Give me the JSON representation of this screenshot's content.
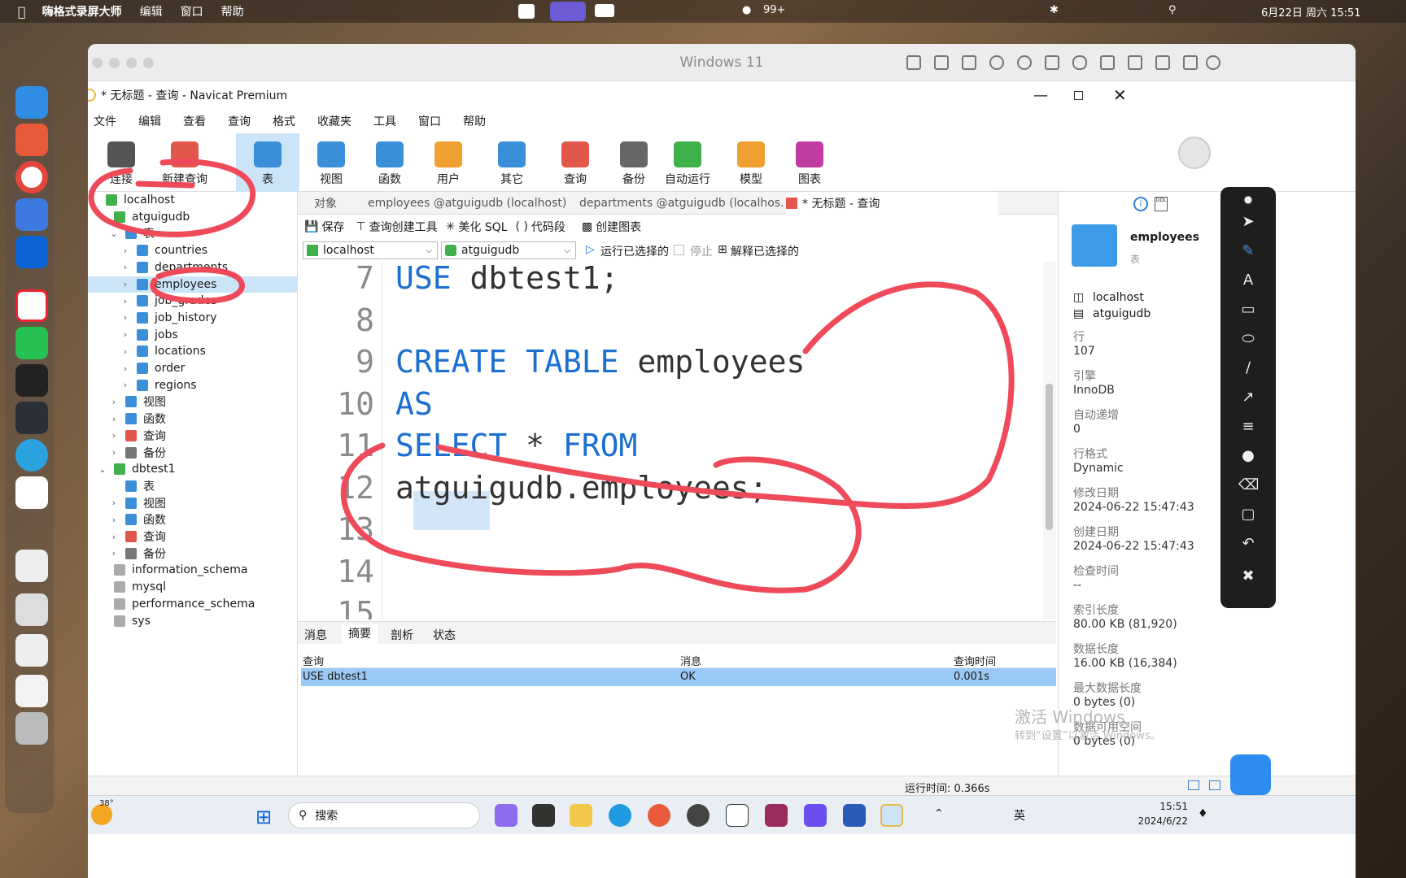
{
  "menubar": {
    "app": "嗨格式录屏大师",
    "items": [
      "编辑",
      "窗口",
      "帮助"
    ],
    "badge": "99+",
    "datetime": "6月22日 周六 15:51"
  },
  "vm": {
    "title": "Windows 11"
  },
  "navicat": {
    "window_title": "* 无标题 - 查询 - Navicat Premium",
    "menu": [
      "文件",
      "编辑",
      "查看",
      "查询",
      "格式",
      "收藏夹",
      "工具",
      "窗口",
      "帮助"
    ],
    "toolbar": [
      {
        "label": "连接",
        "icon": "plug-icon"
      },
      {
        "label": "新建查询",
        "icon": "new-query-icon"
      },
      {
        "label": "表",
        "icon": "table-icon"
      },
      {
        "label": "视图",
        "icon": "view-icon"
      },
      {
        "label": "函数",
        "icon": "function-icon"
      },
      {
        "label": "用户",
        "icon": "user-icon"
      },
      {
        "label": "其它",
        "icon": "tools-icon"
      },
      {
        "label": "查询",
        "icon": "query-icon"
      },
      {
        "label": "备份",
        "icon": "backup-icon"
      },
      {
        "label": "自动运行",
        "icon": "robot-icon"
      },
      {
        "label": "模型",
        "icon": "model-icon"
      },
      {
        "label": "图表",
        "icon": "chart-icon"
      }
    ],
    "tree": {
      "connection": "localhost",
      "db1": "atguigudb",
      "tables_label": "表",
      "tables": [
        "countries",
        "departments",
        "employees",
        "job_grades",
        "job_history",
        "jobs",
        "locations",
        "order",
        "regions"
      ],
      "db1_children": [
        "视图",
        "函数",
        "查询",
        "备份"
      ],
      "db2": "dbtest1",
      "db2_children": [
        "表",
        "视图",
        "函数",
        "查询",
        "备份"
      ],
      "others": [
        "information_schema",
        "mysql",
        "performance_schema",
        "sys"
      ]
    },
    "tabs": [
      "对象",
      "employees @atguigudb (localhost) ...",
      "departments @atguigudb (localhos...",
      "* 无标题 - 查询"
    ],
    "query_toolbar": [
      "保存",
      "查询创建工具",
      "美化 SQL",
      "代码段",
      "创建图表"
    ],
    "conn_select": "localhost",
    "db_select": "atguigudb",
    "run_actions": [
      "运行已选择的",
      "停止",
      "解释已选择的"
    ],
    "editor": {
      "lines": [
        {
          "n": "7",
          "code": [
            {
              "t": "USE ",
              "k": 1
            },
            {
              "t": "dbtest1;",
              "k": 0
            }
          ]
        },
        {
          "n": "8",
          "code": []
        },
        {
          "n": "9",
          "code": [
            {
              "t": "CREATE TABLE ",
              "k": 1
            },
            {
              "t": "employees",
              "k": 0
            }
          ]
        },
        {
          "n": "10",
          "code": [
            {
              "t": "AS",
              "k": 1
            }
          ]
        },
        {
          "n": "11",
          "code": [
            {
              "t": "SELECT",
              "k": 1
            },
            {
              "t": " * ",
              "k": 0
            },
            {
              "t": "FROM",
              "k": 1
            }
          ]
        },
        {
          "n": "12",
          "code": [
            {
              "t": "atguigudb.employees;",
              "k": 0
            }
          ]
        },
        {
          "n": "13",
          "code": []
        },
        {
          "n": "14",
          "code": []
        },
        {
          "n": "15",
          "code": []
        }
      ]
    },
    "result_tabs": [
      "消息",
      "摘要",
      "剖析",
      "状态"
    ],
    "result_headers": [
      "查询",
      "消息",
      "查询时间"
    ],
    "result_row": [
      "USE dbtest1",
      "OK",
      "0.001s"
    ],
    "status": "运行时间: 0.366s",
    "info": {
      "name": "employees",
      "type": "表",
      "host": "localhost",
      "db": "atguigudb",
      "props": [
        [
          "行",
          "107"
        ],
        [
          "引擎",
          "InnoDB"
        ],
        [
          "自动递增",
          "0"
        ],
        [
          "行格式",
          "Dynamic"
        ],
        [
          "修改日期",
          "2024-06-22 15:47:43"
        ],
        [
          "创建日期",
          "2024-06-22 15:47:43"
        ],
        [
          "检查时间",
          "--"
        ],
        [
          "索引长度",
          "80.00 KB (81,920)"
        ],
        [
          "数据长度",
          "16.00 KB (16,384)"
        ],
        [
          "最大数据长度",
          "0 bytes (0)"
        ],
        [
          "数据可用空间",
          "0 bytes (0)"
        ]
      ]
    },
    "watermark": [
      "激活 Windows",
      "转到“设置”以激活 Windows。"
    ]
  },
  "taskbar": {
    "weather": "38°",
    "search": "搜索",
    "ime": "英",
    "time": "15:51",
    "date": "2024/6/22"
  },
  "colors": {
    "keyword": "#1c6fd0",
    "selection": "#cce4f7",
    "ink": "#ef4a5a"
  }
}
